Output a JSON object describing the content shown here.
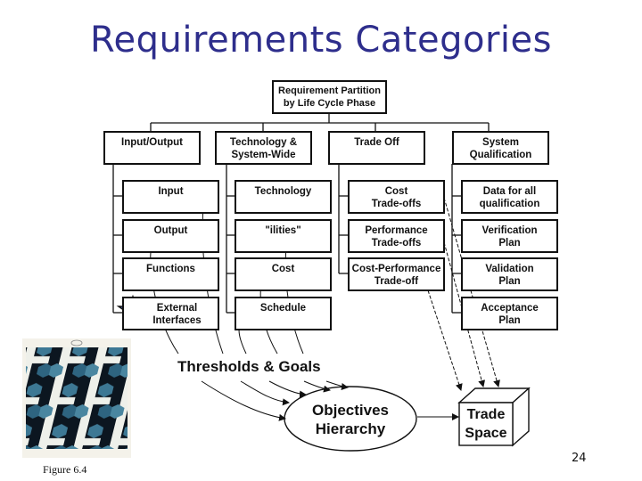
{
  "title": "Requirements Categories",
  "root": {
    "line1": "Requirement Partition",
    "line2": "by Life Cycle Phase"
  },
  "categories": [
    {
      "label_lines": [
        "Input/Output"
      ],
      "children": [
        {
          "lines": [
            "Input"
          ]
        },
        {
          "lines": [
            "Output"
          ]
        },
        {
          "lines": [
            "Functions"
          ]
        },
        {
          "lines": [
            "External",
            "Interfaces"
          ]
        }
      ]
    },
    {
      "label_lines": [
        "Technology &",
        "System-Wide"
      ],
      "children": [
        {
          "lines": [
            "Technology"
          ]
        },
        {
          "lines": [
            "\"ilities\""
          ]
        },
        {
          "lines": [
            "Cost"
          ]
        },
        {
          "lines": [
            "Schedule"
          ]
        }
      ]
    },
    {
      "label_lines": [
        "Trade Off"
      ],
      "children": [
        {
          "lines": [
            "Cost",
            "Trade-offs"
          ]
        },
        {
          "lines": [
            "Performance",
            "Trade-offs"
          ]
        },
        {
          "lines": [
            "Cost-Performance",
            "Trade-off"
          ]
        }
      ]
    },
    {
      "label_lines": [
        "System",
        "Qualification"
      ],
      "children": [
        {
          "lines": [
            "Data for all",
            "qualification"
          ]
        },
        {
          "lines": [
            "Verification",
            "Plan"
          ]
        },
        {
          "lines": [
            "Validation",
            "Plan"
          ]
        },
        {
          "lines": [
            "Acceptance",
            "Plan"
          ]
        }
      ]
    }
  ],
  "thresholds_label": "Thresholds & Goals",
  "objectives": {
    "line1": "Objectives",
    "line2": "Hierarchy"
  },
  "trade_space": {
    "line1": "Trade",
    "line2": "Space"
  },
  "figure_caption": "Figure 6.4",
  "page_number": "24",
  "colors": {
    "title": "#2e2e8c",
    "star": "#5b7fe0",
    "stroke": "#111111"
  }
}
